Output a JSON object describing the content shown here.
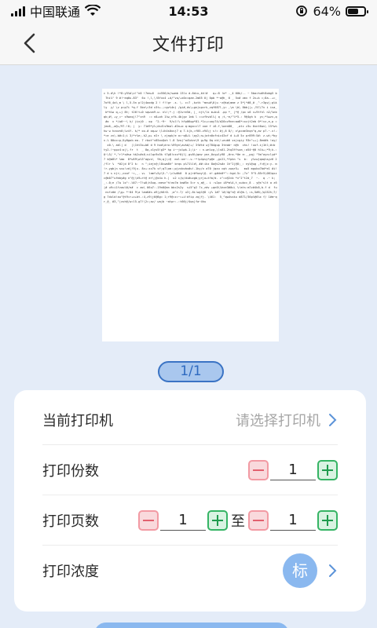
{
  "status_bar": {
    "carrier": "中国联通",
    "time": "14:53",
    "battery": "64%",
    "battery_level": 0.64
  },
  "nav": {
    "title": "文件打印"
  },
  "preview": {
    "page_indicator": "1/1"
  },
  "settings": {
    "printer": {
      "label": "当前打印机",
      "placeholder": "请选择打印机"
    },
    "copies": {
      "label": "打印份数",
      "value": "1"
    },
    "pages": {
      "label": "打印页数",
      "from": "1",
      "to_label": "至",
      "to": "1"
    },
    "density": {
      "label": "打印浓度",
      "badge": "标"
    }
  },
  "colors": {
    "accent": "#3a73c4",
    "badge": "#8ab8ef",
    "minus": "#e2606e",
    "plus": "#1e9b4d"
  }
}
